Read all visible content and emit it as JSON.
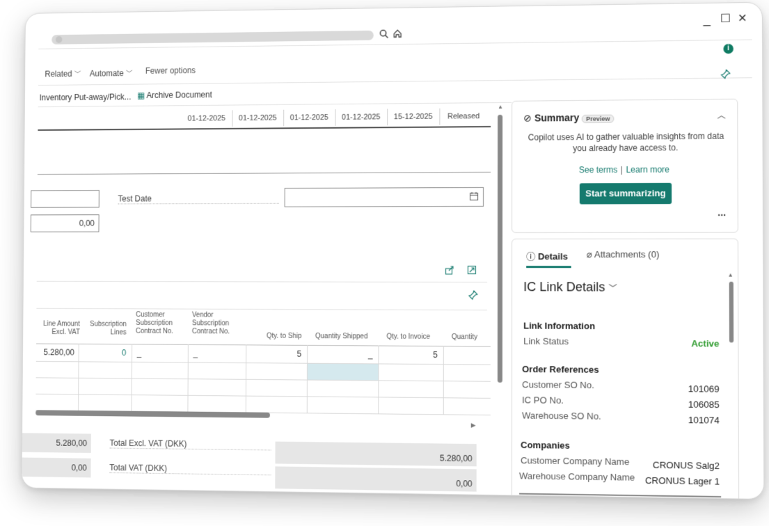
{
  "window": {
    "controls": {
      "minimize": "_",
      "maximize": "☐",
      "close": "✕"
    }
  },
  "menu": {
    "related": "Related",
    "automate": "Automate",
    "fewer_options": "Fewer options"
  },
  "actions": {
    "inventory_putaway": "Inventory Put-away/Pick...",
    "archive_document": "Archive Document"
  },
  "header_dates": [
    "01-12-2025",
    "01-12-2025",
    "01-12-2025",
    "01-12-2025",
    "15-12-2025",
    "Released"
  ],
  "fields": {
    "test_date_label": "Test Date",
    "amount_value": "0,00"
  },
  "lines": {
    "columns": [
      "Line Amount Excl. VAT",
      "Subscription Lines",
      "Customer Subscription Contract No.",
      "Vendor Subscription Contract No.",
      "Qty. to Ship",
      "Quantity Shipped",
      "Qty. to Invoice",
      "Quantity"
    ],
    "row1": {
      "line_amount": "5.280,00",
      "subscription_lines": "0",
      "customer_contract": "_",
      "vendor_contract": "_",
      "qty_to_ship": "5",
      "quantity_shipped": "_",
      "qty_to_invoice": "5"
    }
  },
  "totals": {
    "left_1": "5.280,00",
    "left_2": "0,00",
    "excl_vat_label": "Total Excl. VAT (DKK)",
    "excl_vat_value": "5.280,00",
    "vat_label": "Total VAT (DKK)",
    "vat_value": "0,00"
  },
  "summary": {
    "title": "Summary",
    "badge": "Preview",
    "description_line1": "Copilot uses AI to gather valuable insights from data",
    "description_line2": "you already have access to.",
    "see_terms": "See terms",
    "learn_more": "Learn more",
    "link_separator": "|",
    "button": "Start summarizing",
    "more": "..."
  },
  "factbox": {
    "tab_details": "Details",
    "tab_attachments": "Attachments (0)",
    "title": "IC Link Details",
    "link_info_header": "Link Information",
    "link_status_label": "Link Status",
    "link_status_value": "Active",
    "order_refs_header": "Order References",
    "customer_so_label": "Customer SO No.",
    "customer_so_value": "101069",
    "ic_po_label": "IC PO No.",
    "ic_po_value": "106085",
    "warehouse_so_label": "Warehouse SO No.",
    "warehouse_so_value": "101074",
    "companies_header": "Companies",
    "customer_company_label": "Customer Company Name",
    "customer_company_value": "CRONUS Salg2",
    "warehouse_company_label": "Warehouse Company Name",
    "warehouse_company_value": "CRONUS Lager 1"
  },
  "colors": {
    "accent": "#157a6e",
    "active_status": "#2e9b2e",
    "selected_cell": "#d5e9ee"
  }
}
